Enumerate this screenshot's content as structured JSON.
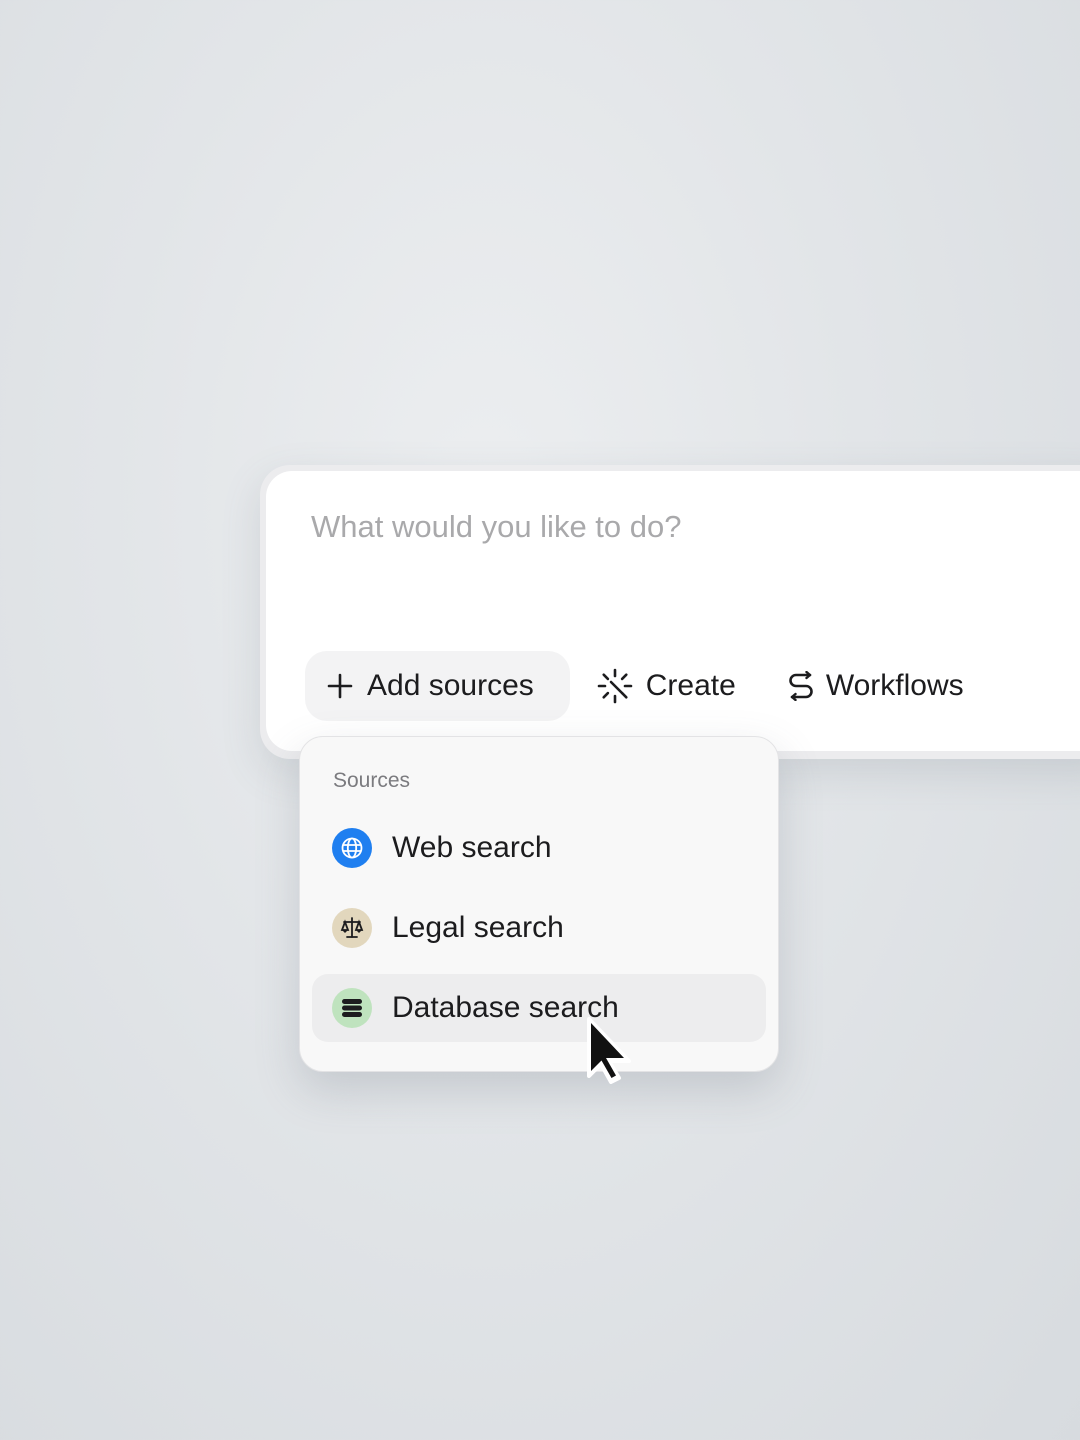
{
  "prompt": {
    "placeholder": "What would you like to do?",
    "value": ""
  },
  "toolbar": {
    "add_sources_label": "Add sources",
    "create_label": "Create",
    "workflows_label": "Workflows"
  },
  "sources_menu": {
    "header": "Sources",
    "items": [
      {
        "label": "Web search",
        "icon": "globe-icon",
        "icon_bg": "#1f7ff0"
      },
      {
        "label": "Legal search",
        "icon": "scales-icon",
        "icon_bg": "#e2d7bd"
      },
      {
        "label": "Database search",
        "icon": "database-icon",
        "icon_bg": "#bfe3be",
        "hovered": true
      }
    ]
  },
  "colors": {
    "background": "#e2e5e8",
    "card": "#ffffff",
    "menu": "#f8f8f8",
    "text": "#1c1c1e",
    "placeholder": "#a9a9ab"
  }
}
